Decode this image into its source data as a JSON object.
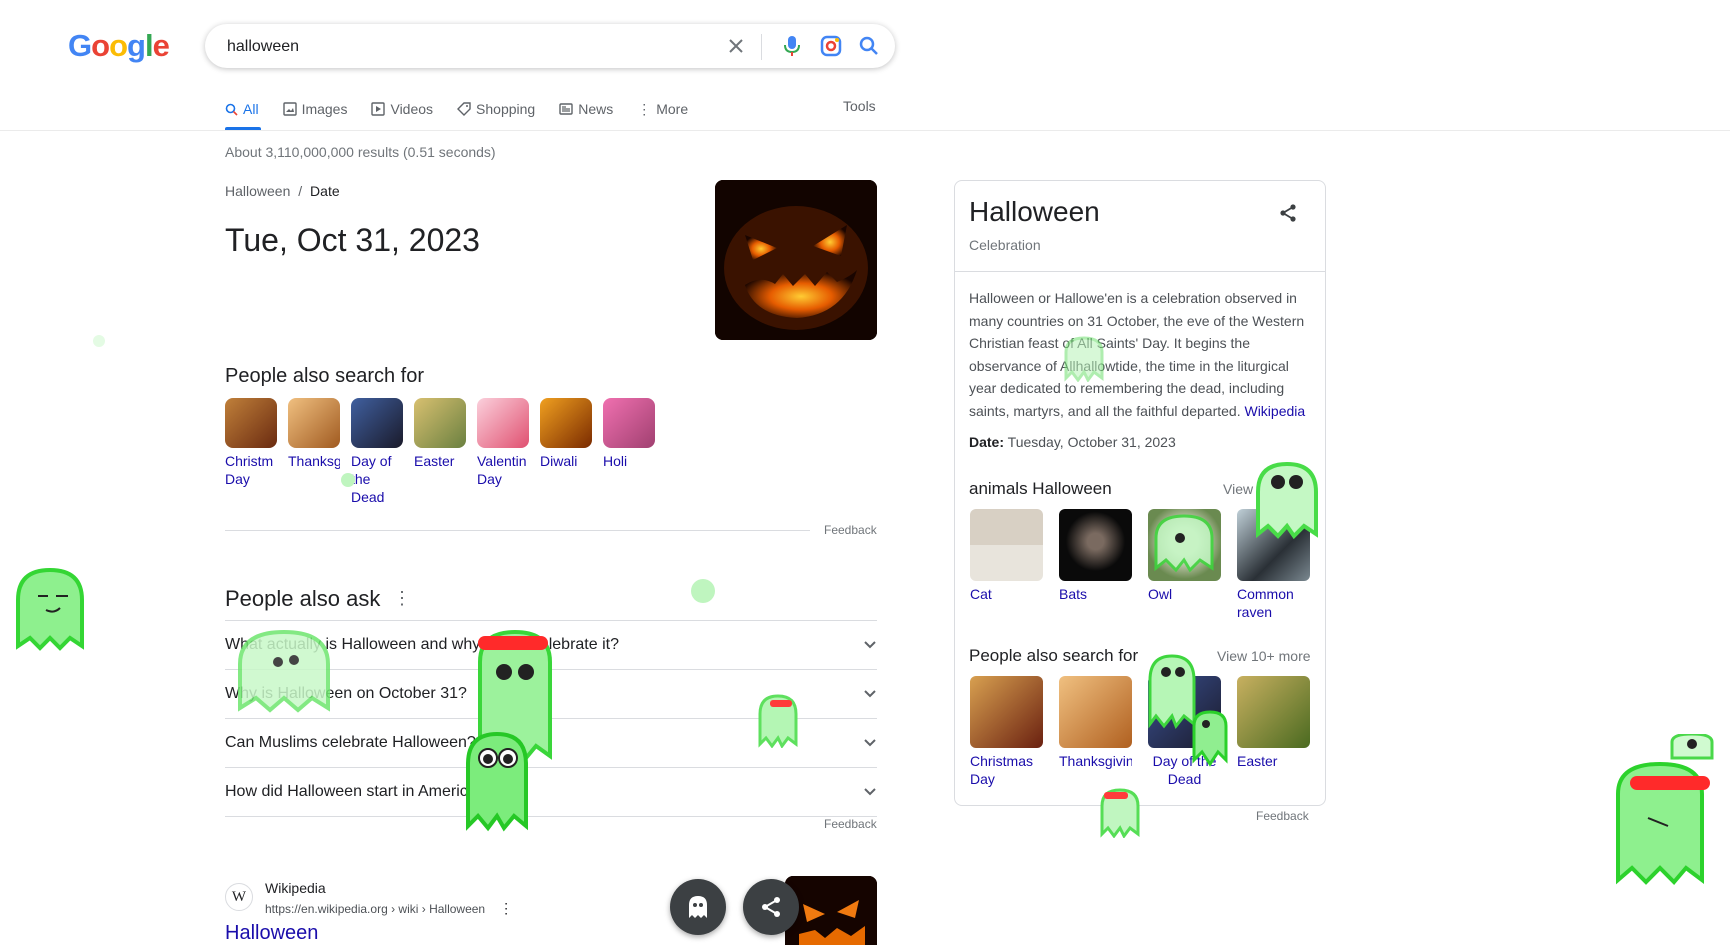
{
  "logo": {
    "letters": [
      "G",
      "o",
      "o",
      "g",
      "l",
      "e"
    ],
    "colors": [
      "#4285F4",
      "#EA4335",
      "#FBBC05",
      "#4285F4",
      "#34A853",
      "#EA4335"
    ]
  },
  "search": {
    "query": "halloween",
    "placeholder": ""
  },
  "tabs": [
    {
      "label": "All",
      "icon": "search-icon",
      "active": true
    },
    {
      "label": "Images",
      "icon": "image-icon"
    },
    {
      "label": "Videos",
      "icon": "video-icon"
    },
    {
      "label": "Shopping",
      "icon": "tag-icon"
    },
    {
      "label": "News",
      "icon": "news-icon"
    },
    {
      "label": "More",
      "icon": "more-vert-icon"
    }
  ],
  "tools_label": "Tools",
  "results_count": "About 3,110,000,000 results (0.51 seconds)",
  "answer": {
    "breadcrumb_parent": "Halloween",
    "breadcrumb_sep": "/",
    "breadcrumb_current": "Date",
    "value": "Tue, Oct 31, 2023"
  },
  "people_also_search": {
    "title": "People also search for",
    "items": [
      {
        "label": "Christm Day",
        "color": "#7a3b1e"
      },
      {
        "label": "Thanksg",
        "color": "#c97a3a"
      },
      {
        "label": "Day of the Dead",
        "color": "#2b3a5a"
      },
      {
        "label": "Easter",
        "color": "#a6a060"
      },
      {
        "label": "Valentin Day",
        "color": "#e8849a"
      },
      {
        "label": "Diwali",
        "color": "#d06a10"
      },
      {
        "label": "Holi",
        "color": "#c45aa0"
      }
    ],
    "feedback": "Feedback"
  },
  "people_also_ask": {
    "title": "People also ask",
    "questions": [
      "What actually is Halloween and why do we celebrate it?",
      "Why is Halloween on October 31?",
      "Can Muslims celebrate Halloween?",
      "How did Halloween start in America?"
    ],
    "feedback": "Feedback"
  },
  "wiki_result": {
    "favicon": "W",
    "source": "Wikipedia",
    "url": "https://en.wikipedia.org › wiki › Halloween",
    "title": "Halloween"
  },
  "knowledge_panel": {
    "title": "Halloween",
    "subtitle": "Celebration",
    "description": "Halloween or Hallowe'en is a celebration observed in many countries on 31 October, the eve of the Western Christian feast of All Saints' Day. It begins the observance of Allhallowtide, the time in the liturgical year dedicated to remembering the dead, including saints, martyrs, and all the faithful departed.",
    "source_link": "Wikipedia",
    "date_label": "Date:",
    "date_value": "Tuesday, October 31, 2023",
    "animals": {
      "title": "animals Halloween",
      "view": "View 5",
      "items": [
        {
          "label": "Cat",
          "color": "#c8c0b6"
        },
        {
          "label": "Bats",
          "color": "#1a1a1a"
        },
        {
          "label": "Owl",
          "color": "#8a9a70"
        },
        {
          "label": "Common raven",
          "color": "#6a7a80"
        }
      ]
    },
    "also_search": {
      "title": "People also search for",
      "view": "View 10+ more",
      "items": [
        {
          "label": "Christmas Day",
          "color": "#8a2f1c"
        },
        {
          "label": "Thanksgiving",
          "color": "#b8783a"
        },
        {
          "label": "Day of the Dead",
          "color": "#2a3550"
        },
        {
          "label": "Easter",
          "color": "#7a8a40"
        }
      ]
    },
    "feedback": "Feedback"
  },
  "colors": {
    "accent": "#1a73e8",
    "link": "#1a0dab",
    "ghost": "#4cdd4c"
  }
}
